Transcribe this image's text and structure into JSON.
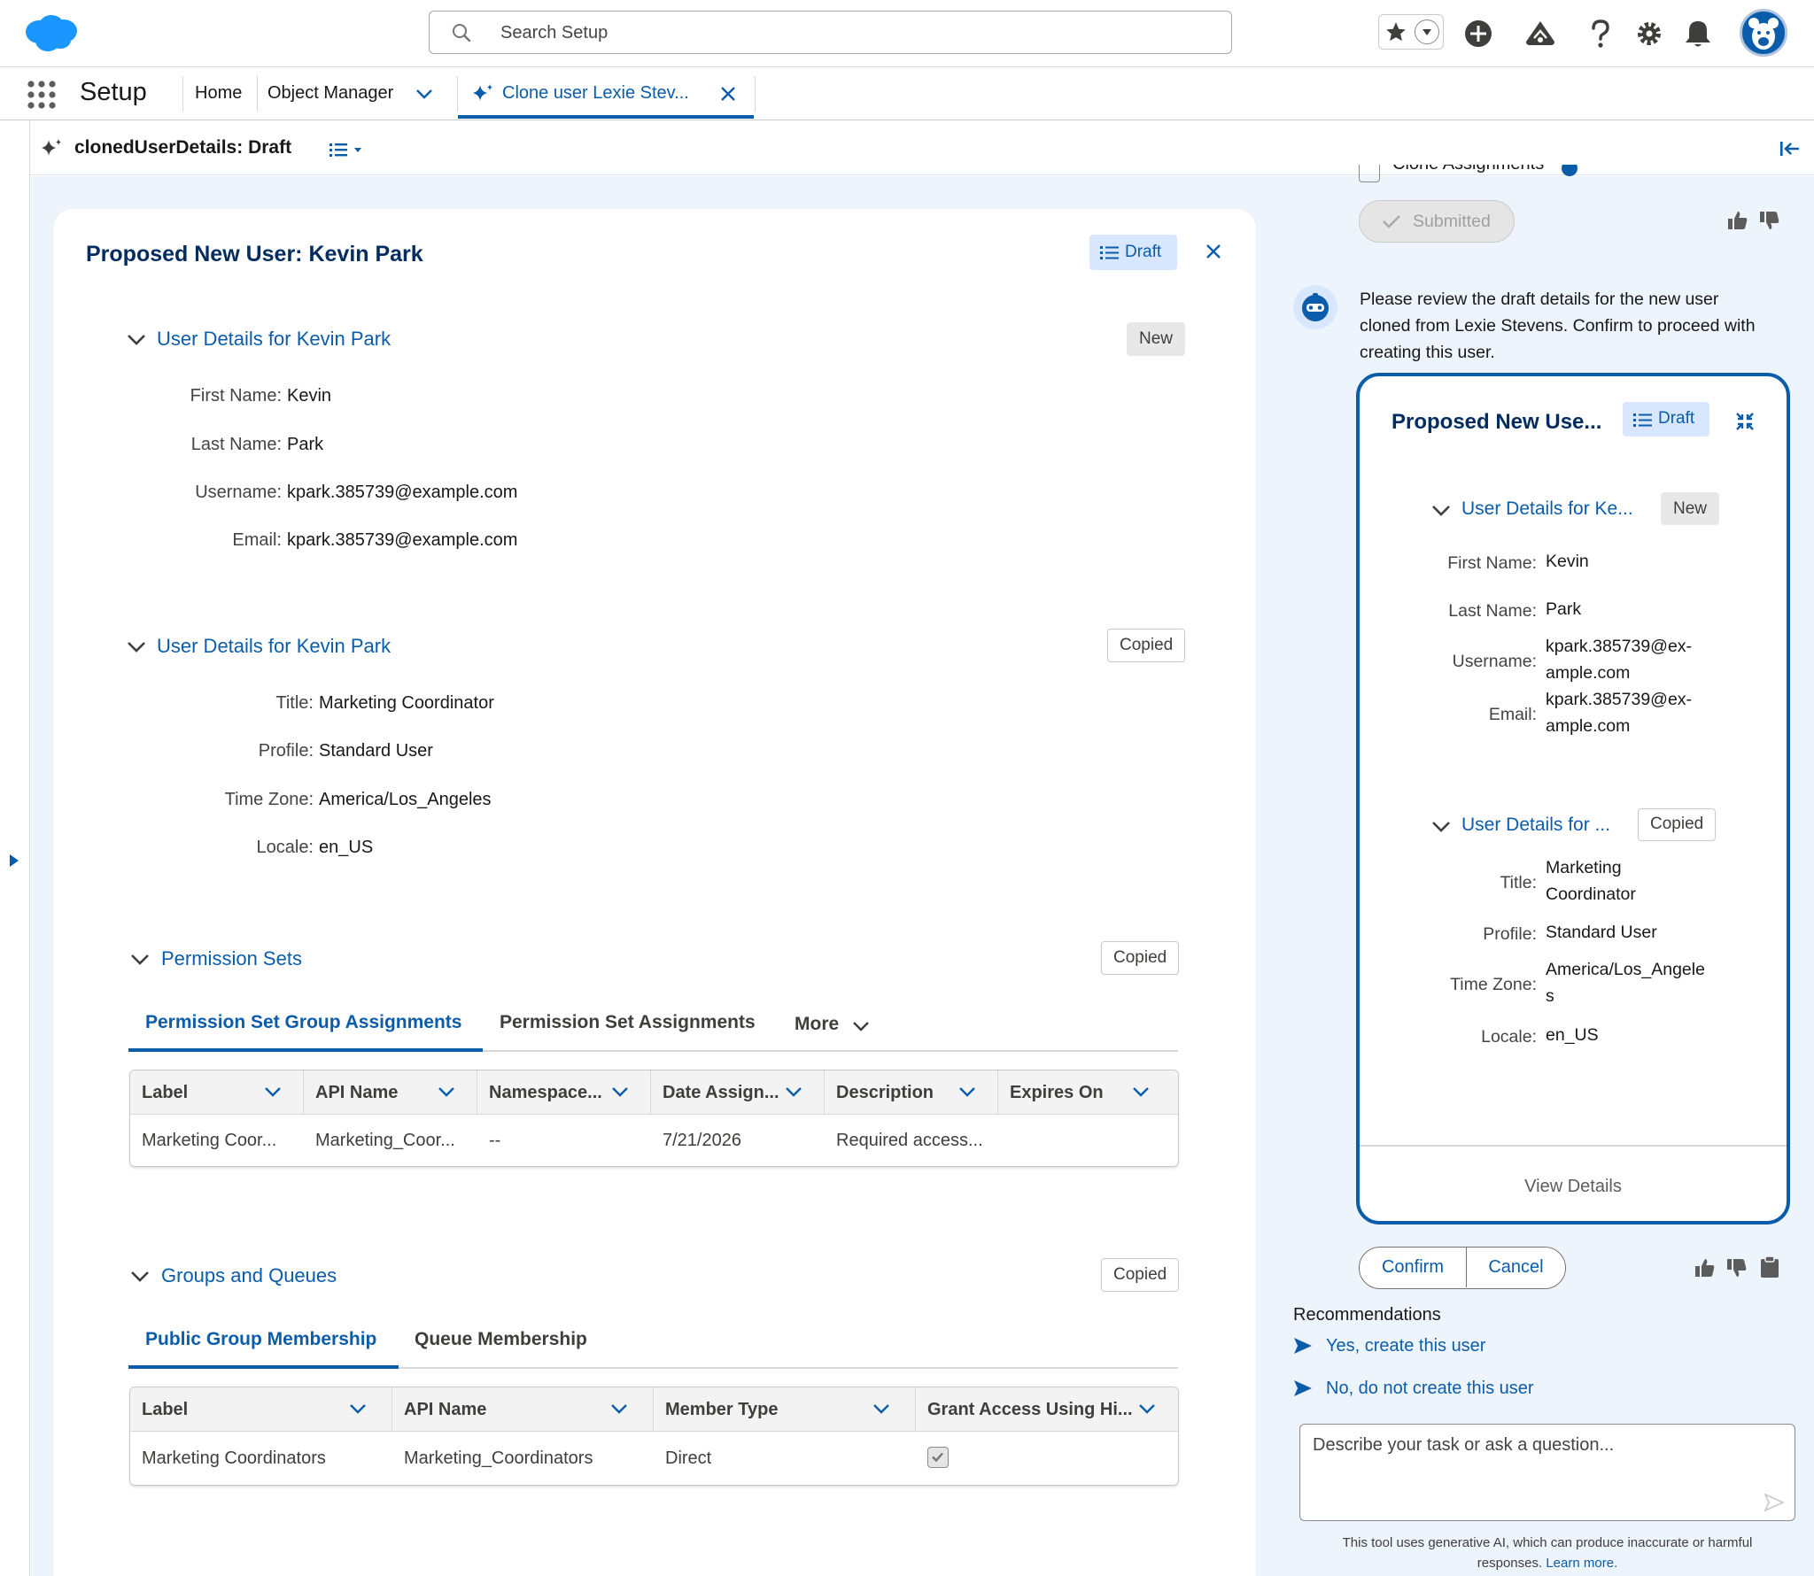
{
  "header": {
    "search_placeholder": "Search Setup",
    "colors": {
      "brand": "#1b96ff",
      "accent": "#0b5cab"
    }
  },
  "nav": {
    "app_name": "Setup",
    "items": [
      "Home",
      "Object Manager"
    ],
    "active_tab": "Clone user Lexie Stev..."
  },
  "subheader": {
    "title": "clonedUserDetails: Draft"
  },
  "main": {
    "title": "Proposed New User: Kevin Park",
    "status": "Draft",
    "section1": {
      "title": "User Details for Kevin Park",
      "badge": "New",
      "fields": [
        {
          "label": "First Name:",
          "value": "Kevin"
        },
        {
          "label": "Last Name:",
          "value": "Park"
        },
        {
          "label": "Username:",
          "value": "kpark.385739@example.com"
        },
        {
          "label": "Email:",
          "value": "kpark.385739@example.com"
        }
      ]
    },
    "section2": {
      "title": "User Details for Kevin Park",
      "badge": "Copied",
      "fields": [
        {
          "label": "Title:",
          "value": "Marketing Coordinator"
        },
        {
          "label": "Profile:",
          "value": "Standard User"
        },
        {
          "label": "Time Zone:",
          "value": "America/Los_Angeles"
        },
        {
          "label": "Locale:",
          "value": "en_US"
        }
      ]
    },
    "permission_sets": {
      "title": "Permission Sets",
      "badge": "Copied",
      "tabs": [
        "Permission Set Group Assignments",
        "Permission Set Assignments",
        "More"
      ],
      "columns": [
        "Label",
        "API Name",
        "Namespace...",
        "Date Assign...",
        "Description",
        "Expires On"
      ],
      "row": [
        "Marketing Coor...",
        "Marketing_Coor...",
        "--",
        "7/21/2026",
        "Required access...",
        ""
      ]
    },
    "groups": {
      "title": "Groups and Queues",
      "badge": "Copied",
      "tabs": [
        "Public Group Membership",
        "Queue Membership"
      ],
      "columns": [
        "Label",
        "API Name",
        "Member Type",
        "Grant Access Using Hi..."
      ],
      "row": [
        "Marketing Coordinators",
        "Marketing_Coordinators",
        "Direct"
      ],
      "grant_access_checked": true
    }
  },
  "panel": {
    "clipped_text": "Clone Assignments",
    "submitted_label": "Submitted",
    "message_lines": [
      "Please review the draft details for the new user",
      "cloned from Lexie Stevens. Confirm to proceed with",
      "creating this user."
    ],
    "card": {
      "title": "Proposed New Use...",
      "status": "Draft",
      "section1": {
        "title": "User Details for Ke...",
        "badge": "New",
        "fields": [
          {
            "label": "First Name:",
            "value": [
              "Kevin"
            ]
          },
          {
            "label": "Last Name:",
            "value": [
              "Park"
            ]
          },
          {
            "label": "Username:",
            "value": [
              "kpark.385739@ex-",
              "ample.com"
            ]
          },
          {
            "label": "Email:",
            "value": [
              "kpark.385739@ex-",
              "ample.com"
            ]
          }
        ]
      },
      "section2": {
        "title": "User Details for ...",
        "badge": "Copied",
        "fields": [
          {
            "label": "Title:",
            "value": [
              "Marketing",
              "Coordinator"
            ]
          },
          {
            "label": "Profile:",
            "value": [
              "Standard User"
            ]
          },
          {
            "label": "Time Zone:",
            "value": [
              "America/Los_Angele",
              "s"
            ]
          },
          {
            "label": "Locale:",
            "value": [
              "en_US"
            ]
          }
        ]
      },
      "view_details": "View Details"
    },
    "confirm_label": "Confirm",
    "cancel_label": "Cancel",
    "recommendations_title": "Recommendations",
    "recommendations": [
      "Yes, create this user",
      "No, do not create this user"
    ],
    "ask_placeholder": "Describe your task or ask a question...",
    "disclaimer": "This tool uses generative AI, which can produce inaccurate or harmful",
    "disclaimer_2": "responses.",
    "learn_more": "Learn more."
  }
}
